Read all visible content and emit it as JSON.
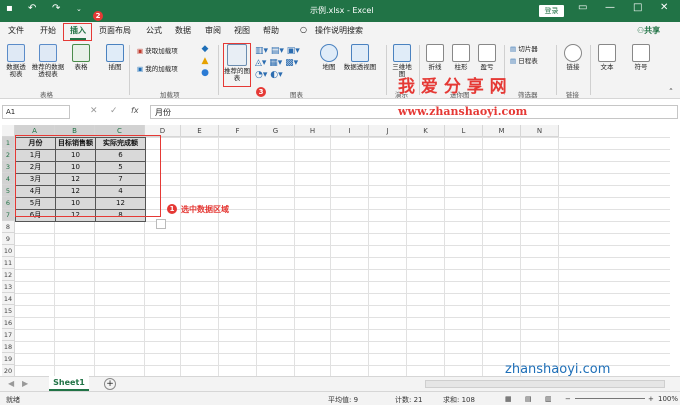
{
  "titlebar": {
    "filename": "示例.xlsx - Excel",
    "login": "登录"
  },
  "tabs": {
    "file": "文件",
    "home": "开始",
    "insert": "插入",
    "layout": "页面布局",
    "formulas": "公式",
    "data": "数据",
    "review": "审阅",
    "view": "视图",
    "help": "帮助",
    "search": "操作说明搜索",
    "share": "共享"
  },
  "badges": {
    "b1": "1",
    "b2": "2",
    "b3": "3"
  },
  "ribbon": {
    "pivot": "数据透视表",
    "rec_pivot": "推荐的数据透视表",
    "table": "表格",
    "illus": "插图",
    "get_addins": "获取加载项",
    "my_addins": "我的加载项",
    "rec_charts": "推荐的图表",
    "maps": "地图",
    "pivot_chart": "数据透视图",
    "map3d": "三维地图",
    "line": "折线",
    "column": "柱形",
    "winloss": "盈亏",
    "slicer": "切片器",
    "timeline": "日程表",
    "link": "链接",
    "text": "文本",
    "symbol": "符号",
    "g_tables": "表格",
    "g_addins": "加载项",
    "g_charts": "图表",
    "g_tours": "演示",
    "g_spark": "迷你图",
    "g_filter": "筛选器",
    "g_links": "链接"
  },
  "formula": {
    "namebox": "A1",
    "content": "月份",
    "fx": "fx"
  },
  "columns": [
    "A",
    "B",
    "C",
    "D",
    "E",
    "F",
    "G",
    "H",
    "I",
    "J",
    "K",
    "L",
    "M",
    "N"
  ],
  "rows": [
    "1",
    "2",
    "3",
    "4",
    "5",
    "6",
    "7",
    "8",
    "9",
    "10",
    "11",
    "12",
    "13",
    "14",
    "15",
    "16",
    "17",
    "18",
    "19",
    "20"
  ],
  "table": {
    "headers": [
      "月份",
      "目标销售额",
      "实际完成额"
    ],
    "data": [
      [
        "1月",
        "10",
        "6"
      ],
      [
        "2月",
        "10",
        "5"
      ],
      [
        "3月",
        "12",
        "7"
      ],
      [
        "4月",
        "12",
        "4"
      ],
      [
        "5月",
        "10",
        "12"
      ],
      [
        "6月",
        "12",
        "8"
      ]
    ]
  },
  "annotation": {
    "select": "选中数据区域"
  },
  "watermark": {
    "cn": "我 爱 分 享 网",
    "url": "www.zhanshaoyi.com",
    "url2": "zhanshaoyi.com"
  },
  "sheet": {
    "tab": "Sheet1"
  },
  "status": {
    "ready": "就绪",
    "avg": "平均值: 9",
    "count": "计数: 21",
    "sum": "求和: 108",
    "zoom": "100%"
  }
}
